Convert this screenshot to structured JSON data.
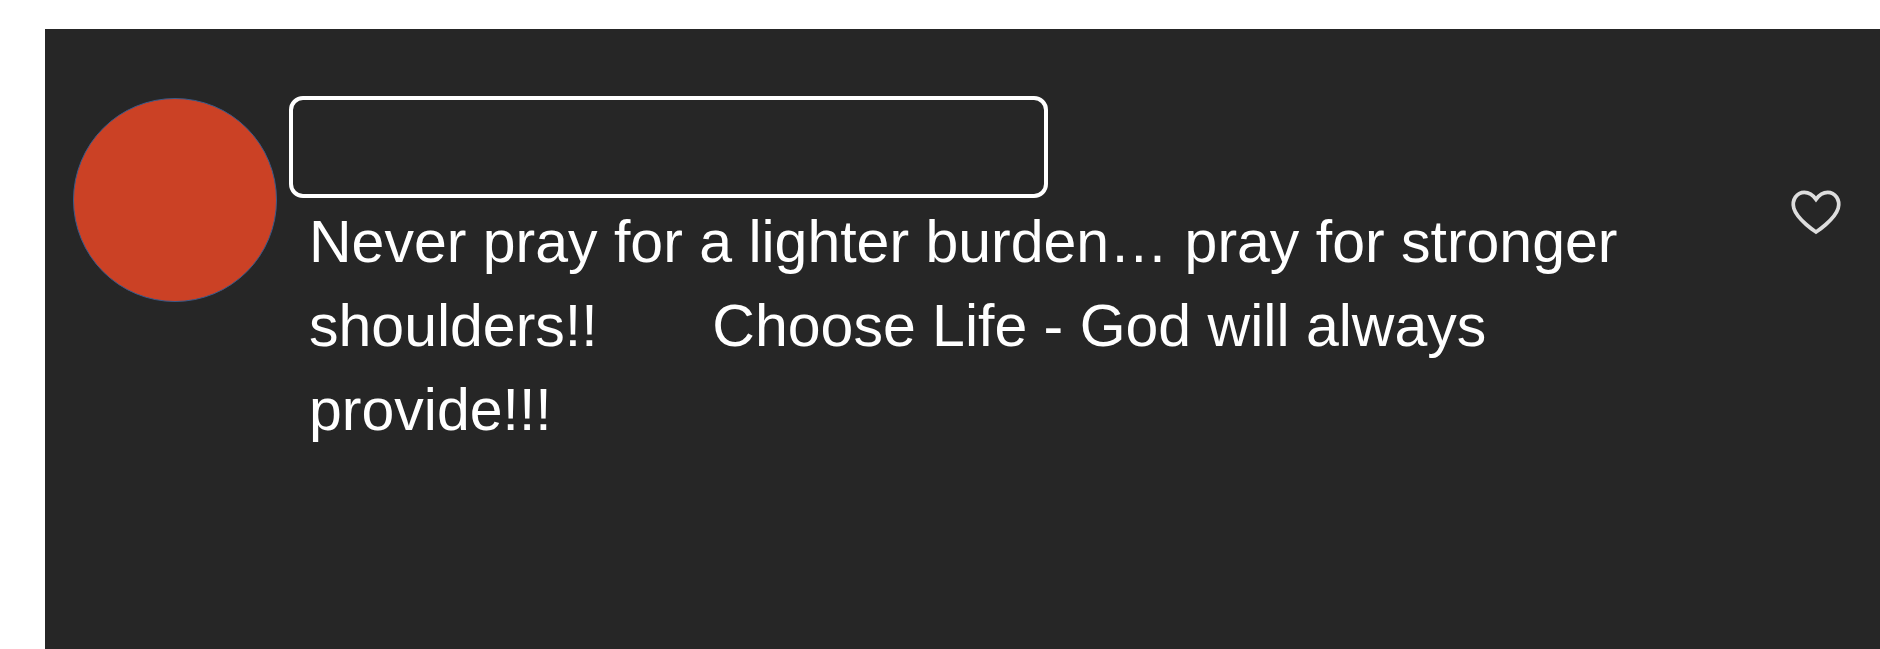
{
  "comment": {
    "text": "Never pray for a lighter burden… pray for stronger shoulders!!       Choose Life - God will always provide!!!",
    "liked": false
  }
}
